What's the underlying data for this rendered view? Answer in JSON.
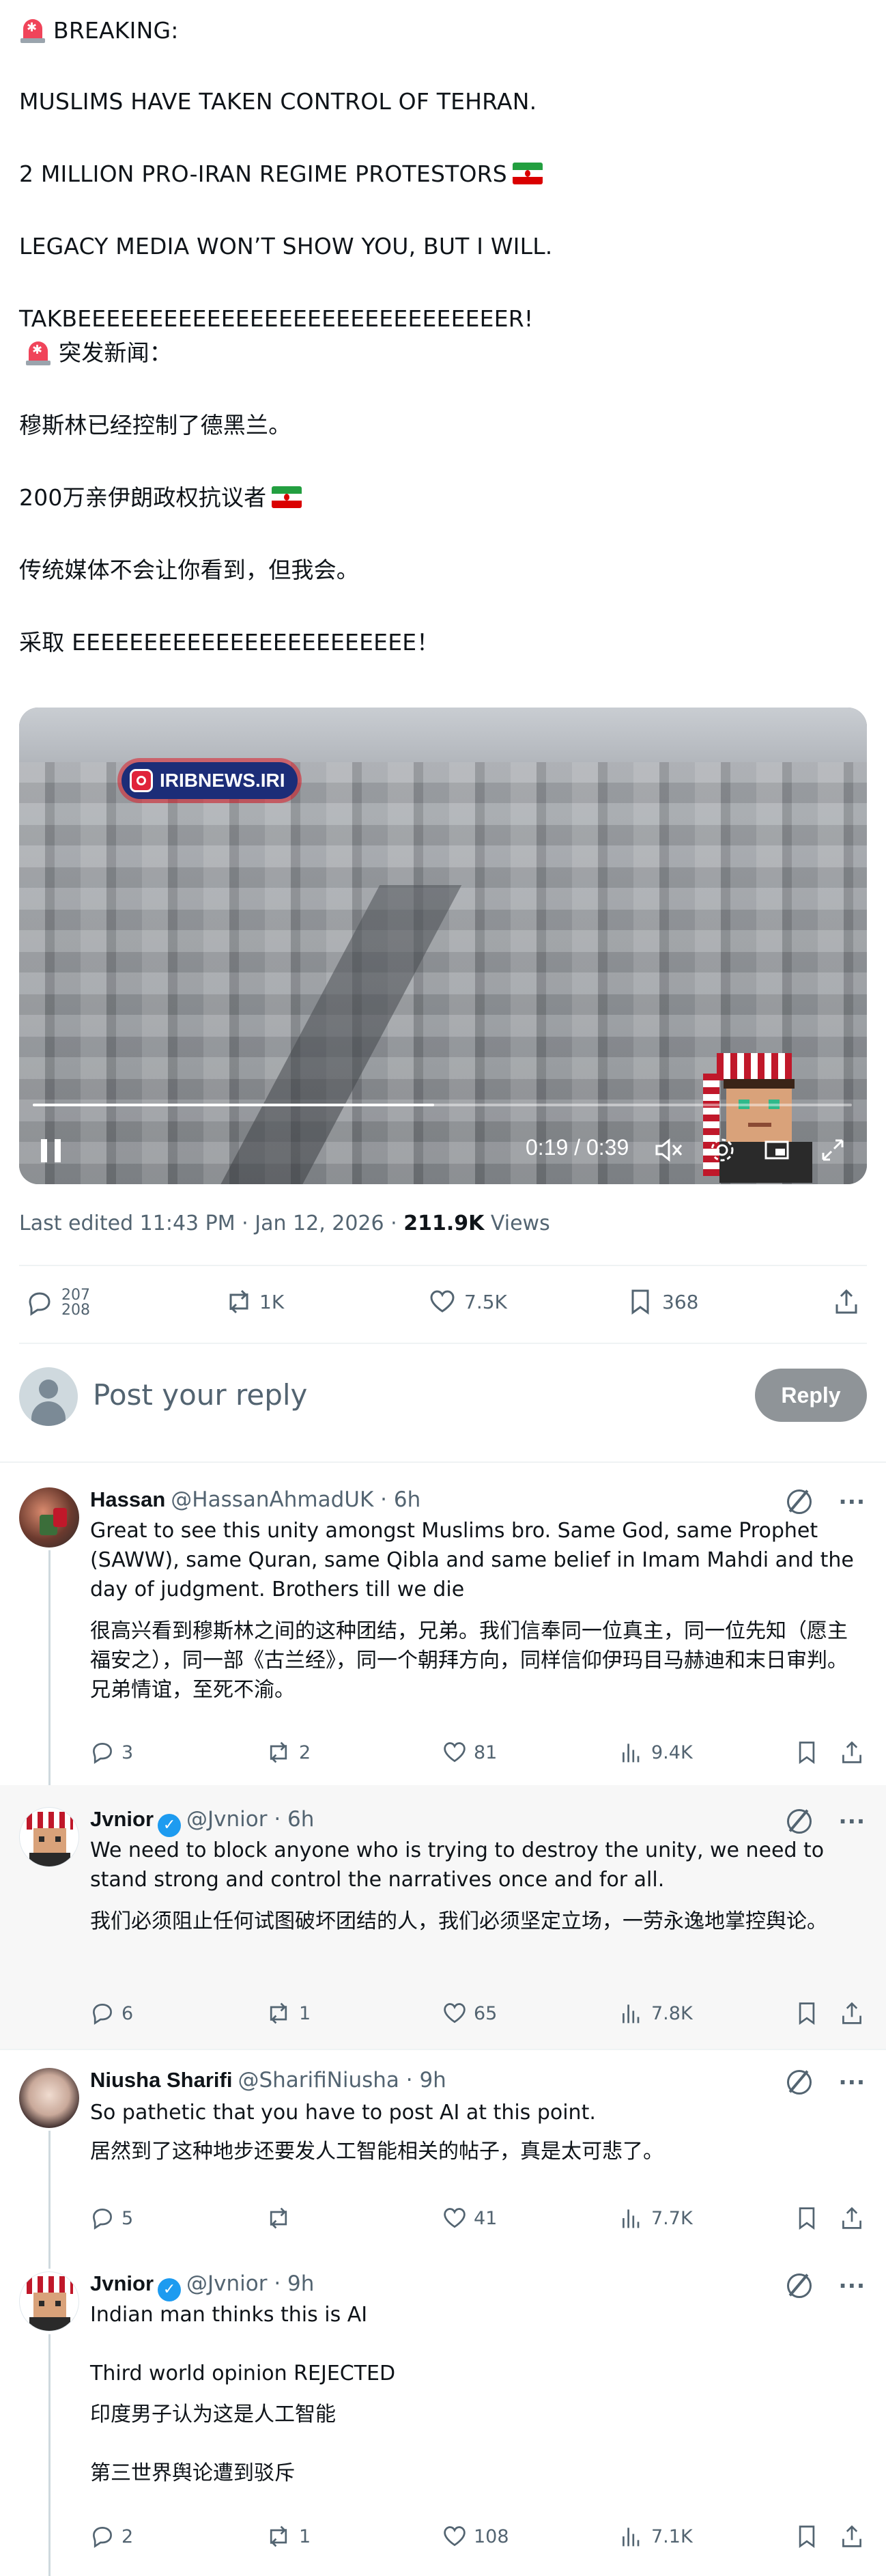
{
  "post": {
    "en_lines": [
      "BREAKING:",
      "MUSLIMS HAVE TAKEN CONTROL OF TEHRAN.",
      "2 MILLION PRO-IRAN REGIME PROTESTORS",
      "LEGACY MEDIA WON’T SHOW YOU, BUT I WILL.",
      "TAKBEEEEEEEEEEEEEEEEEEEEEEEEEEEEEER!"
    ],
    "zh_lines": [
      "突发新闻：",
      "穆斯林已经控制了德黑兰。",
      "200万亲伊朗政权抗议者",
      "传统媒体不会让你看到，但我会。",
      "采取 EEEEEEEEEEEEEEEEEEEEEEEE！"
    ]
  },
  "video": {
    "watermark": "IRIBNEWS.IRI",
    "time": "0:19 / 0:39",
    "progress": 0.49
  },
  "meta": {
    "edited": "Last edited 11:43 PM · Jan 12, 2026 · ",
    "views_count": "211.9K",
    "views_label": " Views"
  },
  "actions": {
    "replies": "207\n208",
    "replies_top": "207",
    "replies_bottom": "208",
    "reposts": "1K",
    "likes": "7.5K",
    "bookmarks": "368"
  },
  "reply_box": {
    "placeholder": "Post your reply",
    "button": "Reply"
  },
  "comments": [
    {
      "name": "Hassan",
      "handle": "@HassanAhmadUK · 6h",
      "verified": false,
      "text_en": "Great to see this unity amongst Muslims bro. Same God, same Prophet (SAWW), same Quran, same Qibla and same belief in Imam Mahdi and the day of judgment. Brothers till we die",
      "text_zh": "很高兴看到穆斯林之间的这种团结，兄弟。我们信奉同一位真主，同一位先知（愿主福安之），同一部《古兰经》，同一个朝拜方向，同样信仰伊玛目马赫迪和末日审判。兄弟情谊，至死不渝。",
      "replies": "3",
      "reposts": "2",
      "likes": "81",
      "views": "9.4K"
    },
    {
      "name": "Jvnior",
      "handle": "@Jvnior · 6h",
      "verified": true,
      "text_en": "We need to block anyone who is trying to destroy the unity, we need to stand strong and control the narratives once and for all.",
      "text_zh": "我们必须阻止任何试图破坏团结的人，我们必须坚定立场，一劳永逸地掌控舆论。",
      "replies": "6",
      "reposts": "1",
      "likes": "65",
      "views": "7.8K"
    },
    {
      "name": "Niusha Sharifi",
      "handle": "@SharifiNiusha · 9h",
      "verified": false,
      "text_en": "So pathetic that you have to post AI at this point.",
      "text_zh": "居然到了这种地步还要发人工智能相关的帖子，真是太可悲了。",
      "replies": "5",
      "reposts": "",
      "likes": "41",
      "views": "7.7K"
    },
    {
      "name": "Jvnior",
      "handle": "@Jvnior · 9h",
      "verified": true,
      "text_en_1": "Indian man thinks this is AI",
      "text_en_2": "Third world opinion REJECTED",
      "text_zh_1": "印度男子认为这是人工智能",
      "text_zh_2": "第三世界舆论遭到驳斥",
      "replies": "2",
      "reposts": "1",
      "likes": "108",
      "views": "7.1K"
    }
  ],
  "colors": {
    "text": "#0f1419",
    "secondary": "#536471",
    "verified": "#1d9bf0",
    "highlight_bg": "#f7f7f7",
    "reply_button": "#8f9498"
  },
  "icons": [
    "siren-icon",
    "iran-flag-icon",
    "pause-icon",
    "mute-icon",
    "settings-icon",
    "fullscreen-icon",
    "reply-icon",
    "repost-icon",
    "like-icon",
    "bookmark-icon",
    "share-icon",
    "views-icon",
    "grok-icon",
    "more-icon",
    "verified-icon",
    "instagram-icon"
  ]
}
